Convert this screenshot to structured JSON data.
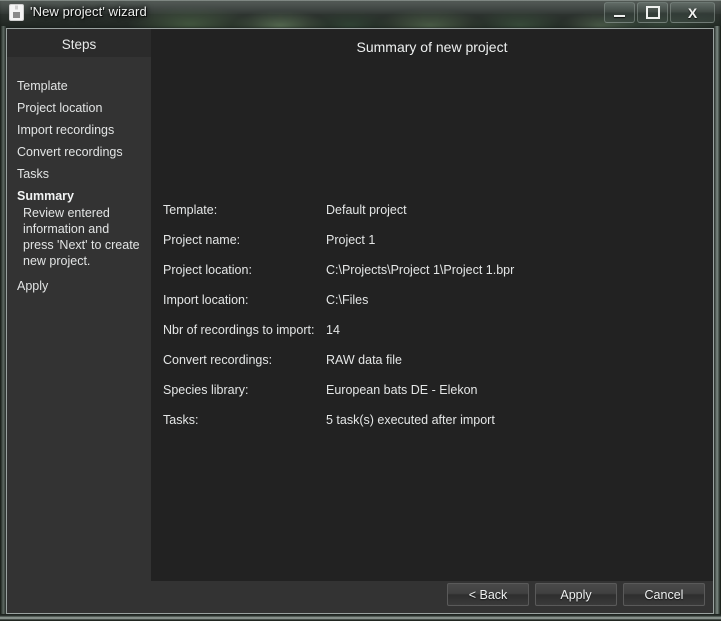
{
  "window": {
    "title": "'New project' wizard",
    "icon": "app-floppy-icon",
    "controls": {
      "minimize": "minimize-icon",
      "maximize": "maximize-icon",
      "close": "X"
    }
  },
  "sidebar": {
    "heading": "Steps",
    "items": [
      {
        "label": "Template",
        "active": false
      },
      {
        "label": "Project location",
        "active": false
      },
      {
        "label": "Import recordings",
        "active": false
      },
      {
        "label": "Convert recordings",
        "active": false
      },
      {
        "label": "Tasks",
        "active": false
      },
      {
        "label": "Summary",
        "active": true
      },
      {
        "label": "Apply",
        "active": false
      }
    ],
    "active_description": "Review entered information and press 'Next' to create new project."
  },
  "main": {
    "title": "Summary of new project",
    "rows": [
      {
        "label": "Template:",
        "value": "Default project"
      },
      {
        "label": "Project name:",
        "value": "Project 1"
      },
      {
        "label": "Project location:",
        "value": "C:\\Projects\\Project 1\\Project 1.bpr"
      },
      {
        "label": "Import location:",
        "value": "C:\\Files"
      },
      {
        "label": "Nbr of recordings to import:",
        "value": "14"
      },
      {
        "label": "Convert recordings:",
        "value": "RAW data file"
      },
      {
        "label": "Species library:",
        "value": "European bats DE - Elekon"
      },
      {
        "label": "Tasks:",
        "value": "5 task(s) executed after import"
      }
    ]
  },
  "footer": {
    "buttons": [
      {
        "label": "< Back"
      },
      {
        "label": "Apply"
      },
      {
        "label": "Cancel"
      }
    ]
  },
  "colors": {
    "sidebar_bg": "#333333",
    "content_bg": "#222222",
    "text": "#e4e6e6",
    "frame_border": "#9aa2a0"
  }
}
